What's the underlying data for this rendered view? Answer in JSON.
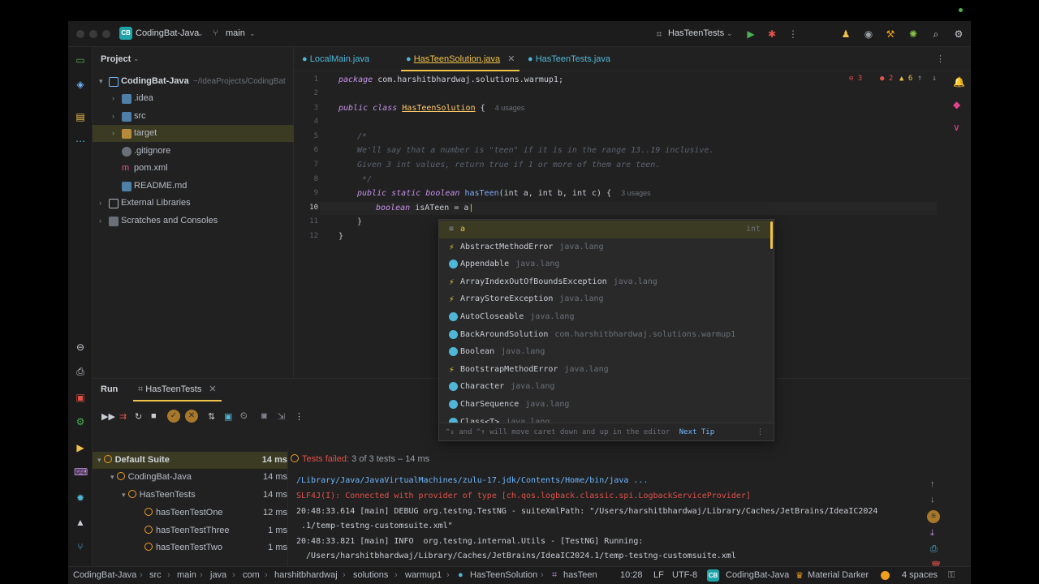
{
  "titlebar": {
    "project_badge": "CB",
    "project_name": "CodingBat-Java",
    "branch": "main",
    "run_config": "HasTeenTests"
  },
  "project_panel": {
    "title": "Project",
    "tree": [
      {
        "label": "CodingBat-Java",
        "path": "~/IdeaProjects/CodingBat",
        "type": "module"
      },
      {
        "label": ".idea",
        "type": "folder"
      },
      {
        "label": "src",
        "type": "folder"
      },
      {
        "label": "target",
        "type": "folder",
        "selected": true
      },
      {
        "label": ".gitignore",
        "type": "file"
      },
      {
        "label": "pom.xml",
        "type": "file"
      },
      {
        "label": "README.md",
        "type": "file"
      },
      {
        "label": "External Libraries",
        "type": "lib"
      },
      {
        "label": "Scratches and Consoles",
        "type": "scratch"
      }
    ]
  },
  "tabs": [
    {
      "label": "LocalMain.java",
      "active": false
    },
    {
      "label": "HasTeenSolution.java",
      "active": true
    },
    {
      "label": "HasTeenTests.java",
      "active": false
    }
  ],
  "editor": {
    "inspections": {
      "errors_a": "3",
      "errors_b": "2",
      "warnings": "6"
    },
    "line_numbers": [
      "1",
      "2",
      "3",
      "4",
      "5",
      "6",
      "7",
      "8",
      "9",
      "10",
      "11",
      "12"
    ],
    "package_kw": "package",
    "package_name": "com.harshitbhardwaj.solutions.warmup1;",
    "class_kw": "public class",
    "class_name": "HasTeenSolution",
    "class_brace": "{",
    "class_usages": "4 usages",
    "comment_open": "/*",
    "comment_1": "We'll say that a number is \"teen\" if it is in the range 13..19 inclusive.",
    "comment_2": "Given 3 int values, return true if 1 or more of them are teen.",
    "comment_close": "*/",
    "method_kw": "public static boolean",
    "method_name": "hasTeen",
    "method_params": "(int a, int b, int c) {",
    "method_usages": "3 usages",
    "line10_kw": "boolean",
    "line10_rest": "isATeen = a",
    "close_1": "}",
    "close_2": "}"
  },
  "completion": {
    "items": [
      {
        "name": "a",
        "pkg": "",
        "type": "int",
        "icon": "variable-icon",
        "color": "#8a8f98"
      },
      {
        "name": "AbstractMethodError",
        "pkg": "java.lang",
        "icon": "exception-icon",
        "color": "#f0c24b"
      },
      {
        "name": "Appendable",
        "pkg": "java.lang",
        "icon": "interface-icon",
        "color": "#4fb6d8"
      },
      {
        "name": "ArrayIndexOutOfBoundsException",
        "pkg": "java.lang",
        "icon": "exception-icon",
        "color": "#f0c24b"
      },
      {
        "name": "ArrayStoreException",
        "pkg": "java.lang",
        "icon": "exception-icon",
        "color": "#f0c24b"
      },
      {
        "name": "AutoCloseable",
        "pkg": "java.lang",
        "icon": "interface-icon",
        "color": "#4fb6d8"
      },
      {
        "name": "BackAroundSolution",
        "pkg": "com.harshitbhardwaj.solutions.warmup1",
        "icon": "class-icon",
        "color": "#4fb6d8"
      },
      {
        "name": "Boolean",
        "pkg": "java.lang",
        "icon": "class-icon",
        "color": "#4fb6d8"
      },
      {
        "name": "BootstrapMethodError",
        "pkg": "java.lang",
        "icon": "exception-icon",
        "color": "#f0c24b"
      },
      {
        "name": "Character",
        "pkg": "java.lang",
        "icon": "class-icon",
        "color": "#4fb6d8"
      },
      {
        "name": "CharSequence",
        "pkg": "java.lang",
        "icon": "interface-icon",
        "color": "#4fb6d8"
      },
      {
        "name": "Class<T>",
        "pkg": "java.lang",
        "icon": "class-icon",
        "color": "#4fb6d8"
      }
    ],
    "footer_hint": "^↓ and ^↑ will move caret down and up in the editor",
    "footer_link": "Next Tip"
  },
  "run_panel": {
    "title": "Run",
    "tab_label": "HasTeenTests",
    "status": "Tests failed:",
    "status_count": "3 of 3 tests – 14 ms",
    "tree": [
      {
        "label": "Default Suite",
        "time": "14 ms",
        "bold": true
      },
      {
        "label": "CodingBat-Java",
        "time": "14 ms"
      },
      {
        "label": "HasTeenTests",
        "time": "14 ms"
      },
      {
        "label": "hasTeenTestOne",
        "time": "12 ms"
      },
      {
        "label": "hasTeenTestThree",
        "time": "1 ms"
      },
      {
        "label": "hasTeenTestTwo",
        "time": "1 ms"
      }
    ],
    "console": [
      "/Library/Java/JavaVirtualMachines/zulu-17.jdk/Contents/Home/bin/java ...",
      "SLF4J(I): Connected with provider of type [ch.qos.logback.classic.spi.LogbackServiceProvider]",
      "20:48:33.614 [main] DEBUG org.testng.TestNG - suiteXmlPath: \"/Users/harshitbhardwaj/Library/Caches/JetBrains/IdeaIC2024",
      " .1/temp-testng-customsuite.xml\"",
      "20:48:33.821 [main] INFO  org.testng.internal.Utils - [TestNG] Running:",
      "  /Users/harshitbhardwaj/Library/Caches/JetBrains/IdeaIC2024.1/temp-testng-customsuite.xml"
    ]
  },
  "statusbar": {
    "breadcrumbs": [
      "CodingBat-Java",
      "src",
      "main",
      "java",
      "com",
      "harshitbhardwaj",
      "solutions",
      "warmup1",
      "HasTeenSolution",
      "hasTeen"
    ],
    "position": "10:28",
    "line_sep": "LF",
    "encoding": "UTF-8",
    "badge": "CB",
    "project": "CodingBat-Java",
    "theme": "Material Darker",
    "indent": "4 spaces"
  },
  "colors": {
    "accent": "#f0c24b",
    "selection": "#3b3a22",
    "badge": "#1ea3a8",
    "error": "#e0524a",
    "warning": "#f0a020"
  }
}
